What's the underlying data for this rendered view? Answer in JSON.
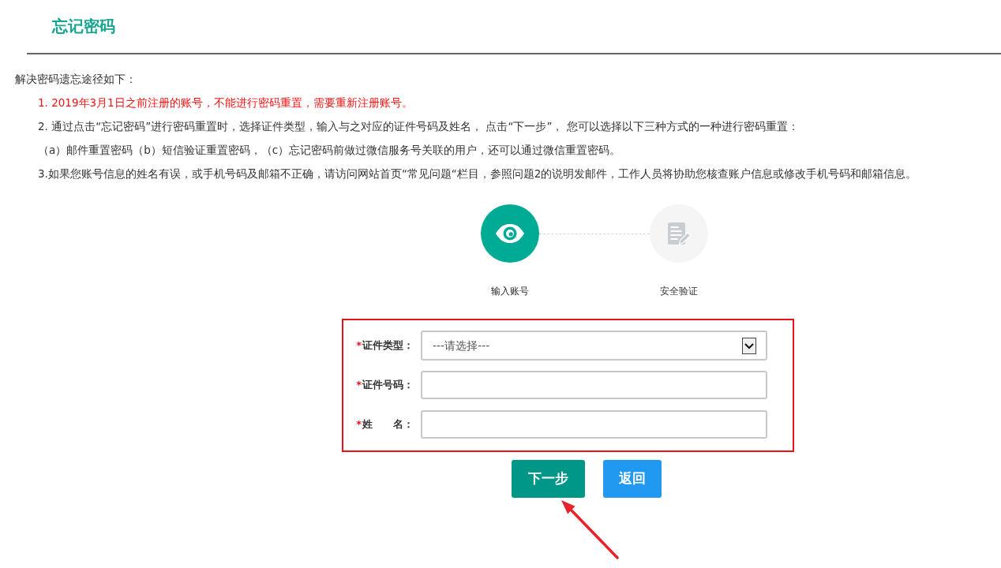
{
  "header": {
    "title": "忘记密码"
  },
  "instructions": {
    "intro": "解决密码遗忘途径如下：",
    "items": [
      {
        "text": "1. 2019年3月1日之前注册的账号，不能进行密码重置，需要重新注册账号。",
        "kind": "warning"
      },
      {
        "text": "2. 通过点击“忘记密码”进行密码重置时，选择证件类型，输入与之对应的证件号码及姓名， 点击“下一步”， 您可以选择以下三种方式的一种进行密码重置：",
        "kind": "note"
      },
      {
        "text": "（a）邮件重置密码（b）短信验证重置密码，（c）忘记密码前做过微信服务号关联的用户，还可以通过微信重置密码。",
        "kind": "note"
      },
      {
        "text": "3.如果您账号信息的姓名有误，或手机号码及邮箱不正确，请访问网站首页“常见问题“栏目，参照问题2的说明发邮件，工作人员将协助您核查账户信息或修改手机号码和邮箱信息。",
        "kind": "note"
      }
    ]
  },
  "steps": [
    {
      "label": "输入账号",
      "kind": "eye",
      "selected": true
    },
    {
      "label": "安全验证",
      "kind": "document",
      "selected": false
    }
  ],
  "form": {
    "highlighted": true,
    "fields": [
      {
        "required_mark": "*",
        "label": "证件类型：",
        "kind": "select",
        "value": "---请选择---"
      },
      {
        "required_mark": "*",
        "label": "证件号码：",
        "kind": "text"
      },
      {
        "required_mark": "*",
        "label": "姓　　名：",
        "kind": "text"
      }
    ]
  },
  "buttons": [
    {
      "label": "下一步",
      "kind": "primary",
      "pointed_at": true
    },
    {
      "label": "返回",
      "kind": "back",
      "pointed_at": false
    }
  ]
}
